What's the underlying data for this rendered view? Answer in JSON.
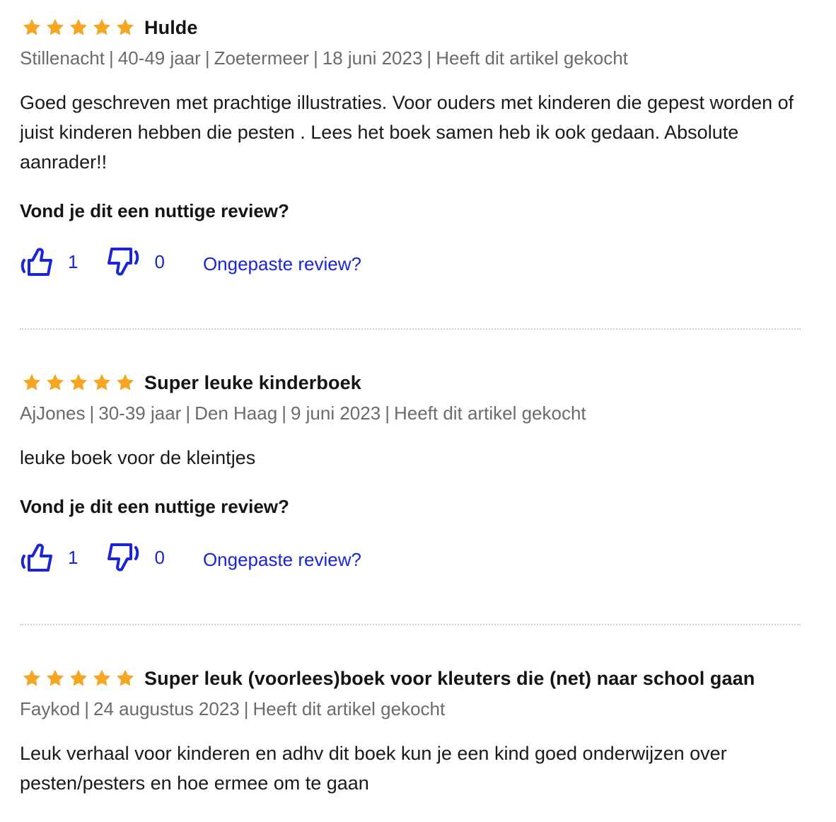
{
  "colors": {
    "star": "#f5a623",
    "link": "#1a25d6",
    "meta": "#6b6b6b"
  },
  "icons": {
    "star": "star-icon",
    "helpful": "thumbs-up-icon",
    "unhelpful": "thumbs-down-icon"
  },
  "reviews": [
    {
      "rating": 5,
      "title": "Hulde",
      "author": "Stillenacht",
      "age": "40-49 jaar",
      "location": "Zoetermeer",
      "date": "18 juni 2023",
      "purchase": "Heeft dit artikel gekocht",
      "body": "Goed geschreven met prachtige illustraties. Voor ouders met kinderen die gepest worden of juist kinderen hebben die pesten . Lees het boek samen heb ik ook gedaan. Absolute aanrader!!",
      "question": "Vond je dit een nuttige review?",
      "helpful_count": "1",
      "unhelpful_count": "0",
      "report_label": "Ongepaste review?"
    },
    {
      "rating": 5,
      "title": "Super leuke kinderboek",
      "author": "AjJones",
      "age": "30-39 jaar",
      "location": "Den Haag",
      "date": "9 juni 2023",
      "purchase": "Heeft dit artikel gekocht",
      "body": "leuke boek voor de kleintjes",
      "question": "Vond je dit een nuttige review?",
      "helpful_count": "1",
      "unhelpful_count": "0",
      "report_label": "Ongepaste review?"
    },
    {
      "rating": 5,
      "title": "Super leuk (voorlees)boek voor kleuters die (net) naar school gaan",
      "author": "Faykod",
      "date": "24 augustus 2023",
      "purchase": "Heeft dit artikel gekocht",
      "body": "Leuk verhaal voor kinderen en adhv dit boek kun je een kind goed onderwijzen over pesten/pesters en hoe ermee om te gaan"
    }
  ]
}
